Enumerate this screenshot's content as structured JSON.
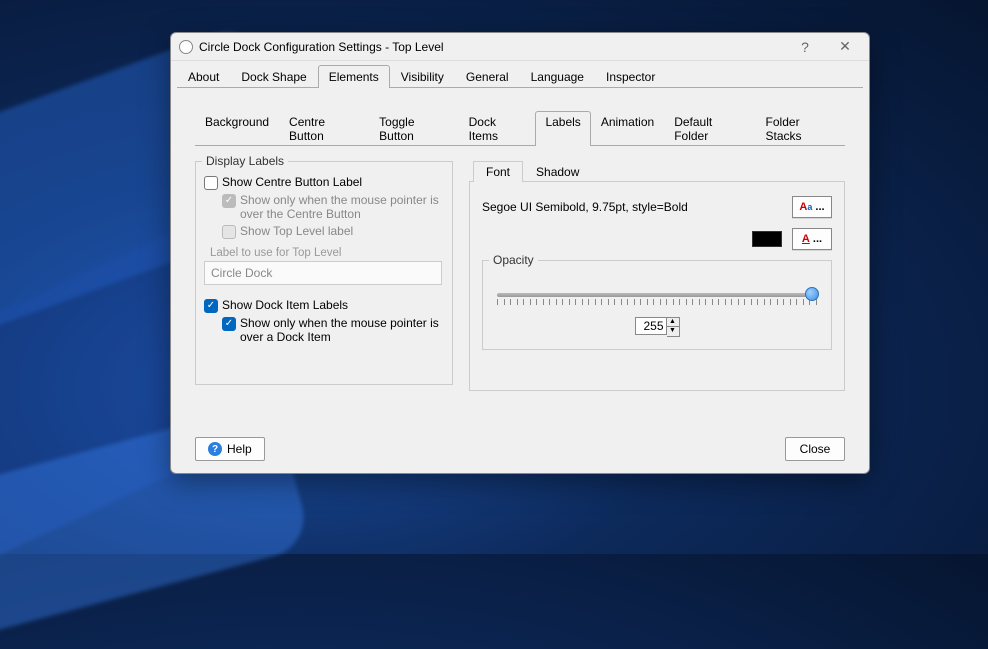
{
  "window": {
    "title": "Circle Dock Configuration Settings - Top Level",
    "help_symbol": "?",
    "close_symbol": "✕"
  },
  "mainTabs": [
    "About",
    "Dock Shape",
    "Elements",
    "Visibility",
    "General",
    "Language",
    "Inspector"
  ],
  "mainTabActive": 2,
  "subTabs": [
    "Background",
    "Centre Button",
    "Toggle Button",
    "Dock Items",
    "Labels",
    "Animation",
    "Default Folder",
    "Folder Stacks"
  ],
  "subTabActive": 4,
  "display": {
    "legend": "Display Labels",
    "showCentreLabel": {
      "label": "Show Centre Button Label",
      "checked": false
    },
    "centreHover": {
      "label": "Show only when the mouse pointer is over the Centre Button",
      "checked": true,
      "disabled": true
    },
    "showTopLevel": {
      "label": "Show Top Level label",
      "checked": false,
      "disabled": true
    },
    "topLevelLabel": "Label to use for Top Level",
    "topLevelValue": "Circle Dock",
    "showDockItemLabels": {
      "label": "Show Dock Item Labels",
      "checked": true
    },
    "dockItemHover": {
      "label": "Show only when the mouse pointer is over a Dock Item",
      "checked": true
    }
  },
  "fontTabs": [
    "Font",
    "Shadow"
  ],
  "fontTabActive": 0,
  "font": {
    "description": "Segoe UI Semibold, 9.75pt, style=Bold",
    "fontBtnText": "Aᵃ ...",
    "colorBtnText": "A ...",
    "colorSwatch": "#000000",
    "opacityLegend": "Opacity",
    "opacityValue": "255"
  },
  "footer": {
    "help": "Help",
    "close": "Close"
  }
}
